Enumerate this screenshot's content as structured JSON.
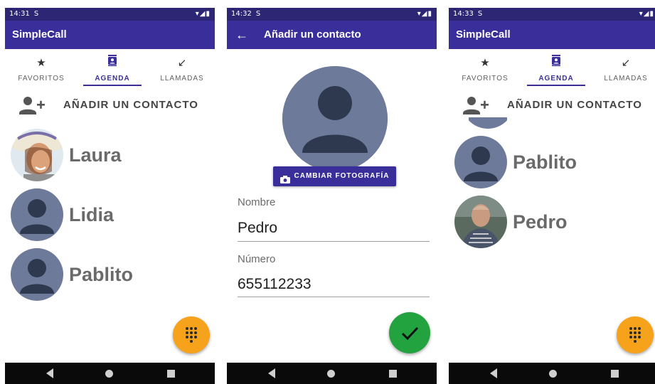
{
  "colors": {
    "status_bar": "#2c2675",
    "app_bar": "#3a2f9a",
    "accent": "#3a2f9a",
    "fab_orange": "#f7a21b",
    "fab_green": "#23a340",
    "avatar_placeholder": "#6d7a9a"
  },
  "screens": [
    {
      "status": {
        "time": "14:31",
        "sync": "S",
        "icons": "▾◢▮"
      },
      "app_title": "SimpleCall",
      "tabs": [
        {
          "icon": "star-icon",
          "label": "FAVORITOS"
        },
        {
          "icon": "contacts-icon",
          "label": "AGENDA",
          "active": true
        },
        {
          "icon": "call-received-icon",
          "label": "LLAMADAS"
        }
      ],
      "add_contact_label": "AÑADIR UN CONTACTO",
      "contacts": [
        {
          "name": "Laura",
          "avatar": "photo"
        },
        {
          "name": "Lidia",
          "avatar": "placeholder"
        },
        {
          "name": "Pablito",
          "avatar": "placeholder"
        }
      ],
      "fab_icon": "dialpad-icon"
    },
    {
      "status": {
        "time": "14:32",
        "sync": "S",
        "icons": "▾◢▮"
      },
      "app_title": "Añadir un contacto",
      "change_photo_label": "CAMBIAR FOTOGRAFÍA",
      "fields": [
        {
          "label": "Nombre",
          "value": "Pedro"
        },
        {
          "label": "Número",
          "value": "655112233"
        }
      ],
      "fab_icon": "check-icon"
    },
    {
      "status": {
        "time": "14:33",
        "sync": "S",
        "icons": "▾◢▮"
      },
      "app_title": "SimpleCall",
      "tabs": [
        {
          "icon": "star-icon",
          "label": "FAVORITOS"
        },
        {
          "icon": "contacts-icon",
          "label": "AGENDA",
          "active": true
        },
        {
          "icon": "call-received-icon",
          "label": "LLAMADAS"
        }
      ],
      "add_contact_label": "AÑADIR UN CONTACTO",
      "contacts": [
        {
          "name": "Pablito",
          "avatar": "placeholder"
        },
        {
          "name": "Pedro",
          "avatar": "photo"
        }
      ],
      "fab_icon": "dialpad-icon"
    }
  ],
  "nav": {
    "back": "back-icon",
    "home": "home-icon",
    "recents": "recents-icon"
  }
}
